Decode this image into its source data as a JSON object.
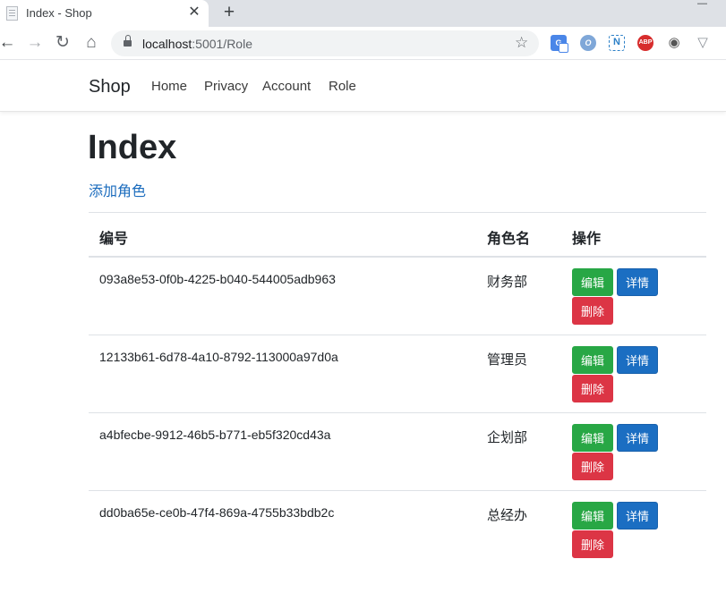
{
  "browser": {
    "tab_title": "Index - Shop",
    "tab_close": "✕",
    "new_tab": "+",
    "url_host": "localhost",
    "url_path": ":5001/Role",
    "extensions": [
      "translate-icon",
      "o-extension-icon",
      "n-extension-icon",
      "adblock-plus-icon",
      "ghost-extension-icon",
      "v-extension-icon"
    ],
    "abp_label": "ABP",
    "n_label": "N",
    "o_label": "O"
  },
  "navbar": {
    "brand": "Shop",
    "links": [
      "Home",
      "Privacy",
      "Account",
      "Role"
    ]
  },
  "page": {
    "title": "Index",
    "add_link": "添加角色"
  },
  "table": {
    "headers": [
      "编号",
      "角色名",
      "操作"
    ],
    "rows": [
      {
        "id": "093a8e53-0f0b-4225-b040-544005adb963",
        "name": "财务部"
      },
      {
        "id": "12133b61-6d78-4a10-8792-113000a97d0a",
        "name": "管理员"
      },
      {
        "id": "a4bfecbe-9912-46b5-b771-eb5f320cd43a",
        "name": "企划部"
      },
      {
        "id": "dd0ba65e-ce0b-47f4-869a-4755b33bdb2c",
        "name": "总经办"
      }
    ],
    "actions": {
      "edit": "编辑",
      "detail": "详情",
      "delete": "删除"
    }
  },
  "colors": {
    "edit": "#28a745",
    "detail": "#1b6ec2",
    "delete": "#dc3545",
    "link": "#1a6bbd"
  }
}
